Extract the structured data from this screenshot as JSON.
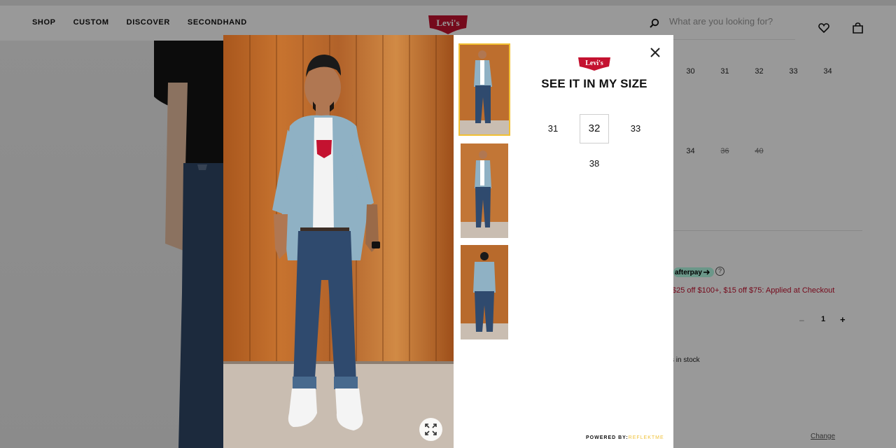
{
  "header": {
    "nav": [
      "SHOP",
      "CUSTOM",
      "DISCOVER",
      "SECONDHAND"
    ],
    "logo_text": "Levi's",
    "search_placeholder": "What are you looking for?"
  },
  "product_panel": {
    "waist_sizes": [
      "30",
      "31",
      "32",
      "33",
      "34"
    ],
    "length_sizes": [
      "34",
      "36",
      "40"
    ],
    "payment_badge": "afterpay",
    "help_icon": "?",
    "promo": "$25 off $100+, $15 off $75: Applied at Checkout",
    "quantity": {
      "minus": "–",
      "value": "1",
      "plus": "+"
    },
    "stock_text": "s in stock",
    "change_link": "Change"
  },
  "modal": {
    "logo_text": "Levi's",
    "title": "SEE IT IN MY SIZE",
    "sizes": [
      "31",
      "32",
      "33",
      "38"
    ],
    "selected_size": "32",
    "powered_by_label": "POWERED BY:",
    "powered_by_brand": "REFLEKTME",
    "icons": {
      "close": "close-icon",
      "expand": "expand-icon"
    }
  },
  "colors": {
    "brand_red": "#c41230",
    "thumb_active_border": "#f2c033",
    "promo_text": "#c41230",
    "afterpay_bg": "#b2fce4"
  }
}
